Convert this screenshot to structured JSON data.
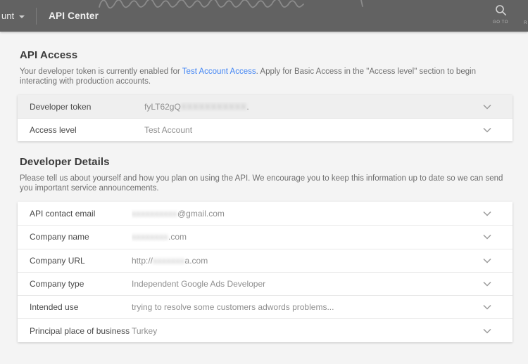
{
  "header": {
    "account_label_truncated": "unt",
    "title": "API Center",
    "go_to_label": "GO TO",
    "right_edge_truncated_label": "R"
  },
  "api_access": {
    "heading": "API Access",
    "intro_before_link": "Your developer token is currently enabled for ",
    "intro_link": "Test Account Access",
    "intro_after_link": ". Apply for Basic Access in the \"Access level\" section to begin interacting with production accounts.",
    "rows": [
      {
        "label": "Developer token",
        "value_prefix": "fyLT62gQ",
        "redacted_placeholder": "XXXXXXXXXXX",
        "value_suffix": "."
      },
      {
        "label": "Access level",
        "value_prefix": "Test Account",
        "redacted_placeholder": "",
        "value_suffix": ""
      }
    ]
  },
  "developer_details": {
    "heading": "Developer Details",
    "description": "Please tell us about yourself and how you plan on using the API. We encourage you to keep this information up to date so we can send you important service announcements.",
    "rows": [
      {
        "label": "API contact email",
        "value_prefix": "",
        "redacted_placeholder": "xxxxxxxxxx",
        "value_suffix": "@gmail.com"
      },
      {
        "label": "Company name",
        "value_prefix": "",
        "redacted_placeholder": "xxxxxxxx",
        "value_suffix": ".com"
      },
      {
        "label": "Company URL",
        "value_prefix": "http://",
        "redacted_placeholder": "xxxxxxx",
        "value_suffix": "a.com"
      },
      {
        "label": "Company type",
        "value_prefix": "Independent Google Ads Developer",
        "redacted_placeholder": "",
        "value_suffix": ""
      },
      {
        "label": "Intended use",
        "value_prefix": "trying to resolve some customers adwords problems...",
        "redacted_placeholder": "",
        "value_suffix": ""
      },
      {
        "label": "Principal place of business",
        "value_prefix": "Turkey",
        "redacted_placeholder": "",
        "value_suffix": ""
      }
    ]
  },
  "colors": {
    "topbar_bg": "#626262",
    "page_bg": "#f4f4f4",
    "link": "#4285f4",
    "active_row_bg": "#efefef"
  }
}
